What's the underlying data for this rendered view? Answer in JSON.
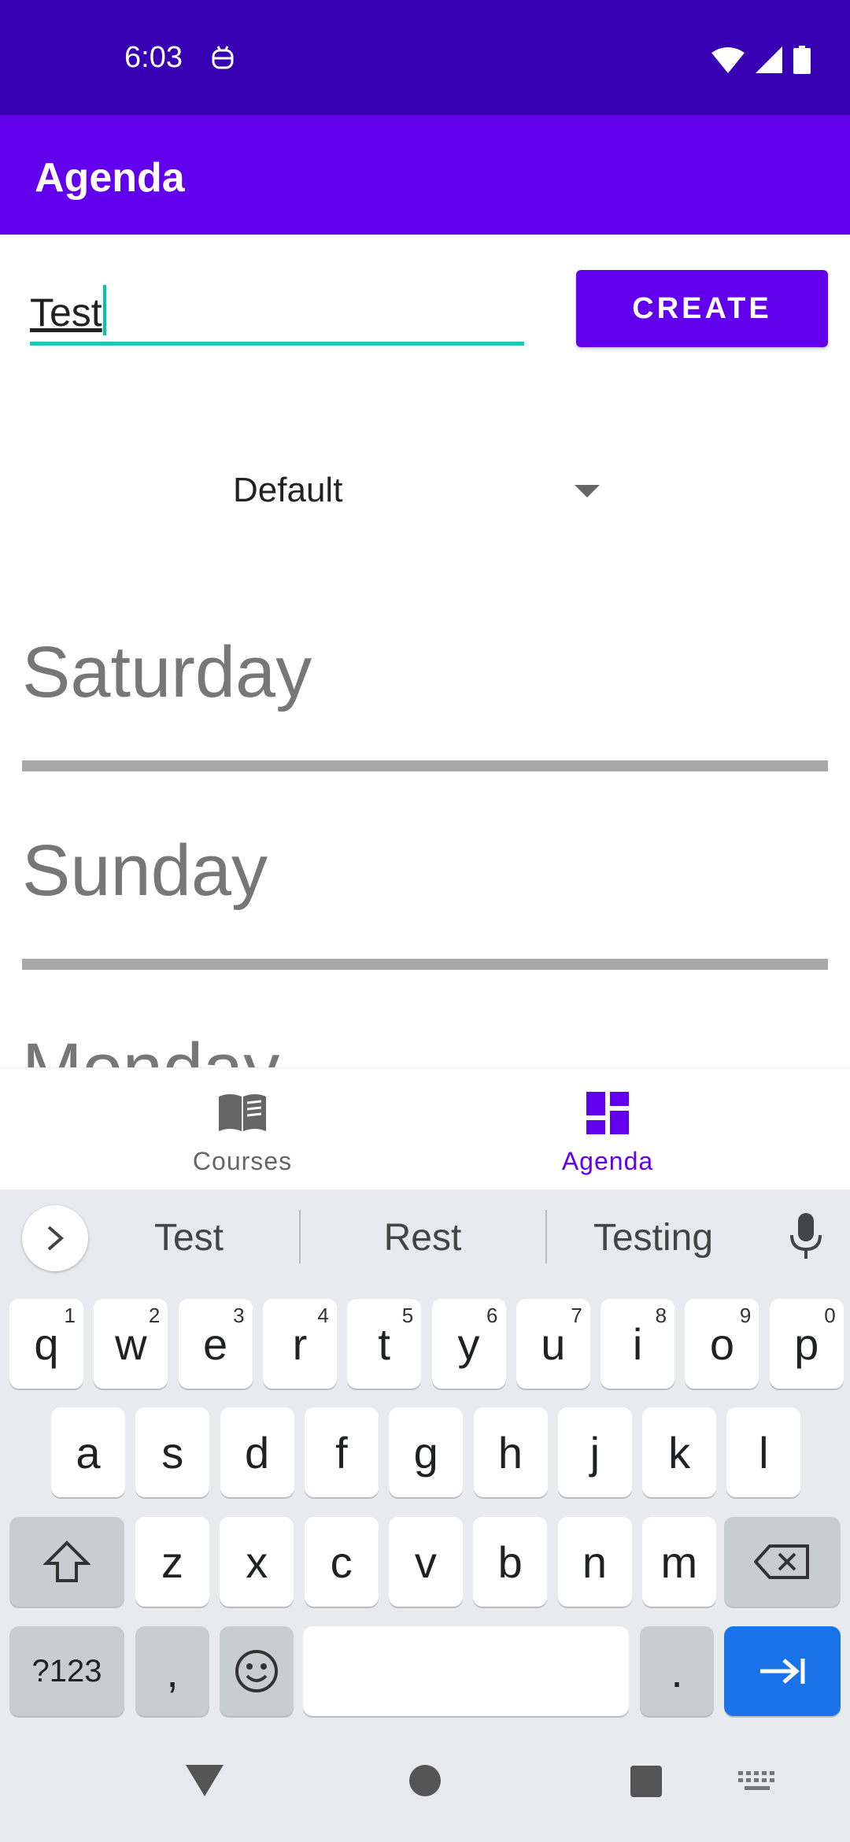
{
  "status_bar": {
    "time": "6:03"
  },
  "app_bar": {
    "title": "Agenda"
  },
  "form": {
    "name_value": "Test",
    "create_label": "CREATE",
    "spinner_value": "Default"
  },
  "days": [
    "Saturday",
    "Sunday",
    "Monday"
  ],
  "bottom_nav": {
    "items": [
      {
        "label": "Courses",
        "icon": "book-icon",
        "selected": false
      },
      {
        "label": "Agenda",
        "icon": "dashboard-icon",
        "selected": true
      }
    ]
  },
  "keyboard": {
    "suggestions": [
      "Test",
      "Rest",
      "Testing"
    ],
    "row1": [
      {
        "k": "q",
        "s": "1"
      },
      {
        "k": "w",
        "s": "2"
      },
      {
        "k": "e",
        "s": "3"
      },
      {
        "k": "r",
        "s": "4"
      },
      {
        "k": "t",
        "s": "5"
      },
      {
        "k": "y",
        "s": "6"
      },
      {
        "k": "u",
        "s": "7"
      },
      {
        "k": "i",
        "s": "8"
      },
      {
        "k": "o",
        "s": "9"
      },
      {
        "k": "p",
        "s": "0"
      }
    ],
    "row2": [
      "a",
      "s",
      "d",
      "f",
      "g",
      "h",
      "j",
      "k",
      "l"
    ],
    "row3": [
      "z",
      "x",
      "c",
      "v",
      "b",
      "n",
      "m"
    ],
    "symbols_label": "?123",
    "comma_label": ",",
    "period_label": "."
  },
  "colors": {
    "status_bar": "#3700b3",
    "primary": "#6200ee",
    "accent": "#03dac5",
    "keyboard_action": "#1a73e8"
  }
}
